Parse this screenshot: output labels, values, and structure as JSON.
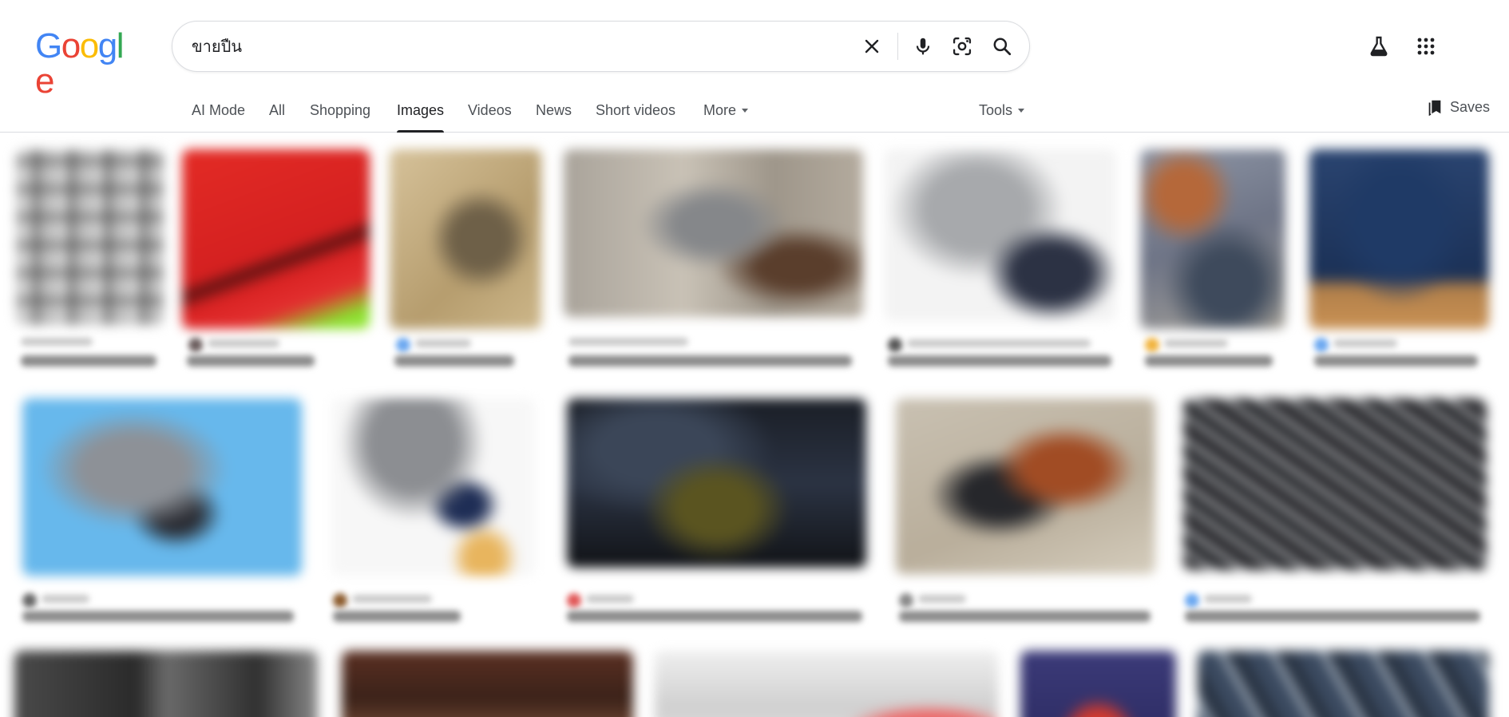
{
  "logo": {
    "letters": [
      "G",
      "o",
      "o",
      "g",
      "l",
      "e"
    ],
    "colors": [
      "#4285F4",
      "#EA4335",
      "#FBBC05",
      "#4285F4",
      "#34A853",
      "#EA4335"
    ]
  },
  "search": {
    "query": "ขายปืน",
    "icons": [
      "close-icon",
      "microphone-icon",
      "lens-icon",
      "search-icon"
    ]
  },
  "top_icons": [
    "labs-flask-icon",
    "apps-grid-icon"
  ],
  "tabs": [
    {
      "label": "AI Mode",
      "active": false
    },
    {
      "label": "All",
      "active": false
    },
    {
      "label": "Shopping",
      "active": false
    },
    {
      "label": "Images",
      "active": true
    },
    {
      "label": "Videos",
      "active": false
    },
    {
      "label": "News",
      "active": false
    },
    {
      "label": "Short videos",
      "active": false
    },
    {
      "label": "More",
      "active": false,
      "dropdown": true
    }
  ],
  "tools": {
    "label": "Tools"
  },
  "saves": {
    "label": "Saves"
  },
  "colors": {
    "active_tab": "#202124",
    "tab_text": "#4d5156",
    "divider": "#dadce0"
  }
}
